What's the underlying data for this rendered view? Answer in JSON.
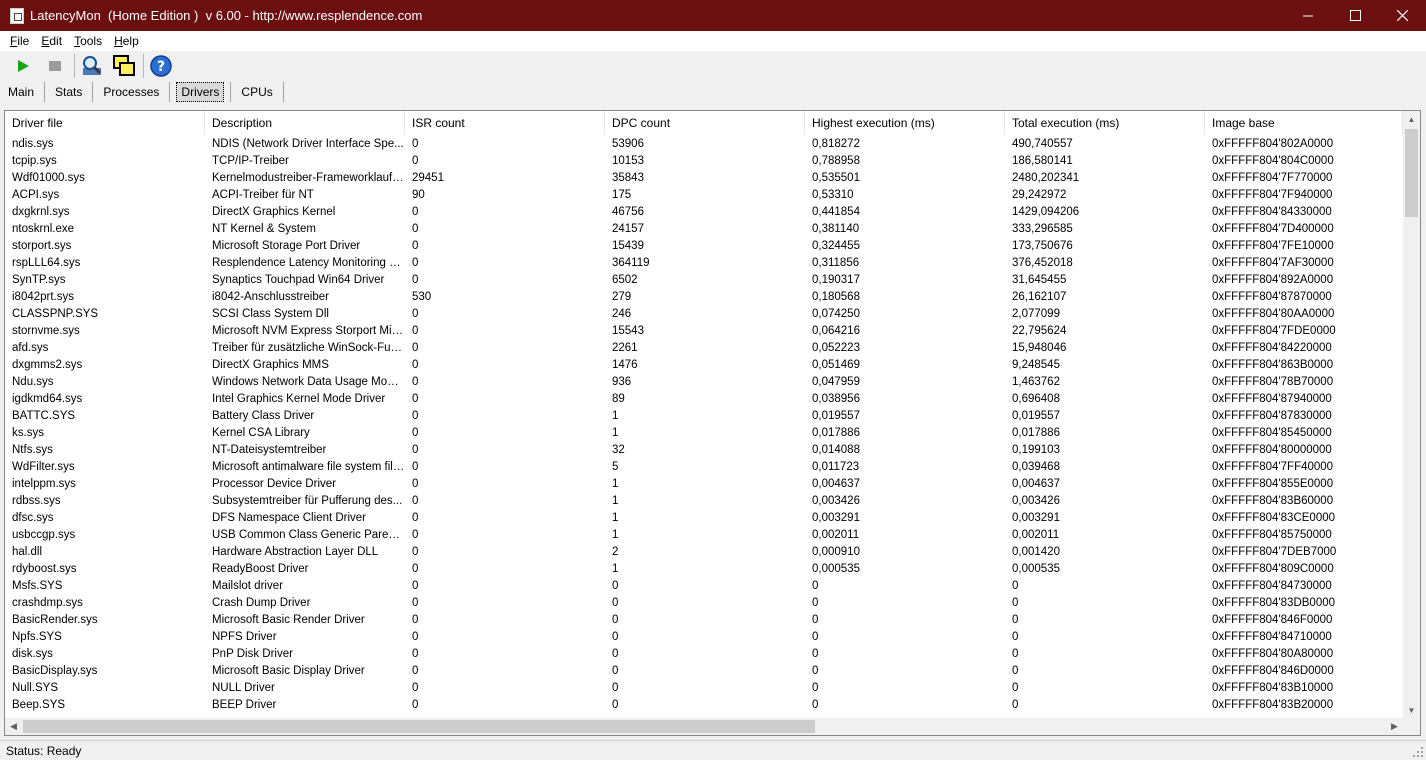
{
  "window": {
    "title": "LatencyMon  (Home Edition )  v 6.00 - http://www.resplendence.com",
    "titlebar_color": "#6b0f10"
  },
  "menu": [
    {
      "label": "File",
      "key": "F",
      "rest": "ile"
    },
    {
      "label": "Edit",
      "key": "E",
      "rest": "dit"
    },
    {
      "label": "Tools",
      "key": "T",
      "rest": "ools"
    },
    {
      "label": "Help",
      "key": "H",
      "rest": "elp"
    }
  ],
  "toolbar": {
    "icons": [
      "play-icon",
      "stop-icon",
      "search-icon",
      "windows-icon",
      "help-icon"
    ]
  },
  "tabs": [
    "Main",
    "Stats",
    "Processes",
    "Drivers",
    "CPUs"
  ],
  "active_tab": "Drivers",
  "table": {
    "columns": [
      "Driver file",
      "Description",
      "ISR count",
      "DPC count",
      "Highest execution (ms)",
      "Total execution (ms)",
      "Image base"
    ],
    "rows": [
      [
        "ndis.sys",
        "NDIS (Network Driver Interface Spe...",
        "0",
        "53906",
        "0,818272",
        "490,740557",
        "0xFFFFF804'802A0000"
      ],
      [
        "tcpip.sys",
        "TCP/IP-Treiber",
        "0",
        "10153",
        "0,788958",
        "186,580141",
        "0xFFFFF804'804C0000"
      ],
      [
        "Wdf01000.sys",
        "Kernelmodustreiber-Frameworklaufzeit",
        "29451",
        "35843",
        "0,535501",
        "2480,202341",
        "0xFFFFF804'7F770000"
      ],
      [
        "ACPI.sys",
        "ACPI-Treiber für NT",
        "90",
        "175",
        "0,53310",
        "29,242972",
        "0xFFFFF804'7F940000"
      ],
      [
        "dxgkrnl.sys",
        "DirectX Graphics Kernel",
        "0",
        "46756",
        "0,441854",
        "1429,094206",
        "0xFFFFF804'84330000"
      ],
      [
        "ntoskrnl.exe",
        "NT Kernel & System",
        "0",
        "24157",
        "0,381140",
        "333,296585",
        "0xFFFFF804'7D400000"
      ],
      [
        "storport.sys",
        "Microsoft Storage Port Driver",
        "0",
        "15439",
        "0,324455",
        "173,750676",
        "0xFFFFF804'7FE10000"
      ],
      [
        "rspLLL64.sys",
        "Resplendence Latency Monitoring a...",
        "0",
        "364119",
        "0,311856",
        "376,452018",
        "0xFFFFF804'7AF30000"
      ],
      [
        "SynTP.sys",
        "Synaptics Touchpad Win64 Driver",
        "0",
        "6502",
        "0,190317",
        "31,645455",
        "0xFFFFF804'892A0000"
      ],
      [
        "i8042prt.sys",
        "i8042-Anschlusstreiber",
        "530",
        "279",
        "0,180568",
        "26,162107",
        "0xFFFFF804'87870000"
      ],
      [
        "CLASSPNP.SYS",
        "SCSI Class System Dll",
        "0",
        "246",
        "0,074250",
        "2,077099",
        "0xFFFFF804'80AA0000"
      ],
      [
        "stornvme.sys",
        "Microsoft NVM Express Storport Mini...",
        "0",
        "15543",
        "0,064216",
        "22,795624",
        "0xFFFFF804'7FDE0000"
      ],
      [
        "afd.sys",
        "Treiber für zusätzliche WinSock-Fun...",
        "0",
        "2261",
        "0,052223",
        "15,948046",
        "0xFFFFF804'84220000"
      ],
      [
        "dxgmms2.sys",
        "DirectX Graphics MMS",
        "0",
        "1476",
        "0,051469",
        "9,248545",
        "0xFFFFF804'863B0000"
      ],
      [
        "Ndu.sys",
        "Windows Network Data Usage Monit...",
        "0",
        "936",
        "0,047959",
        "1,463762",
        "0xFFFFF804'78B70000"
      ],
      [
        "igdkmd64.sys",
        "Intel Graphics Kernel Mode Driver",
        "0",
        "89",
        "0,038956",
        "0,696408",
        "0xFFFFF804'87940000"
      ],
      [
        "BATTC.SYS",
        "Battery Class Driver",
        "0",
        "1",
        "0,019557",
        "0,019557",
        "0xFFFFF804'87830000"
      ],
      [
        "ks.sys",
        "Kernel CSA Library",
        "0",
        "1",
        "0,017886",
        "0,017886",
        "0xFFFFF804'85450000"
      ],
      [
        "Ntfs.sys",
        "NT-Dateisystemtreiber",
        "0",
        "32",
        "0,014088",
        "0,199103",
        "0xFFFFF804'80000000"
      ],
      [
        "WdFilter.sys",
        "Microsoft antimalware file system filt...",
        "0",
        "5",
        "0,011723",
        "0,039468",
        "0xFFFFF804'7FF40000"
      ],
      [
        "intelppm.sys",
        "Processor Device Driver",
        "0",
        "1",
        "0,004637",
        "0,004637",
        "0xFFFFF804'855E0000"
      ],
      [
        "rdbss.sys",
        "Subsystemtreiber für Pufferung des...",
        "0",
        "1",
        "0,003426",
        "0,003426",
        "0xFFFFF804'83B60000"
      ],
      [
        "dfsc.sys",
        "DFS Namespace Client Driver",
        "0",
        "1",
        "0,003291",
        "0,003291",
        "0xFFFFF804'83CE0000"
      ],
      [
        "usbccgp.sys",
        "USB Common Class Generic Parent ...",
        "0",
        "1",
        "0,002011",
        "0,002011",
        "0xFFFFF804'85750000"
      ],
      [
        "hal.dll",
        "Hardware Abstraction Layer DLL",
        "0",
        "2",
        "0,000910",
        "0,001420",
        "0xFFFFF804'7DEB7000"
      ],
      [
        "rdyboost.sys",
        "ReadyBoost Driver",
        "0",
        "1",
        "0,000535",
        "0,000535",
        "0xFFFFF804'809C0000"
      ],
      [
        "Msfs.SYS",
        "Mailslot driver",
        "0",
        "0",
        "0",
        "0",
        "0xFFFFF804'84730000"
      ],
      [
        "crashdmp.sys",
        "Crash Dump Driver",
        "0",
        "0",
        "0",
        "0",
        "0xFFFFF804'83DB0000"
      ],
      [
        "BasicRender.sys",
        "Microsoft Basic Render Driver",
        "0",
        "0",
        "0",
        "0",
        "0xFFFFF804'846F0000"
      ],
      [
        "Npfs.SYS",
        "NPFS Driver",
        "0",
        "0",
        "0",
        "0",
        "0xFFFFF804'84710000"
      ],
      [
        "disk.sys",
        "PnP Disk Driver",
        "0",
        "0",
        "0",
        "0",
        "0xFFFFF804'80A80000"
      ],
      [
        "BasicDisplay.sys",
        "Microsoft Basic Display Driver",
        "0",
        "0",
        "0",
        "0",
        "0xFFFFF804'846D0000"
      ],
      [
        "Null.SYS",
        "NULL Driver",
        "0",
        "0",
        "0",
        "0",
        "0xFFFFF804'83B10000"
      ],
      [
        "Beep.SYS",
        "BEEP Driver",
        "0",
        "0",
        "0",
        "0",
        "0xFFFFF804'83B20000"
      ]
    ]
  },
  "status": "Status: Ready"
}
